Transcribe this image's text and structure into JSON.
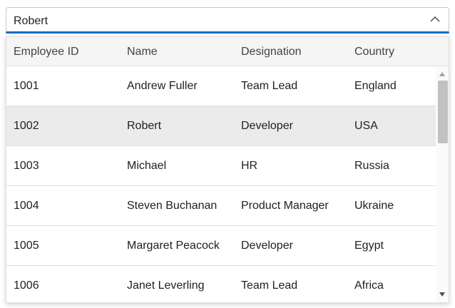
{
  "dropdown": {
    "value": "Robert",
    "icon": "chevron-up-icon"
  },
  "grid": {
    "columns": [
      "Employee ID",
      "Name",
      "Designation",
      "Country"
    ],
    "rows": [
      {
        "id": "1001",
        "name": "Andrew Fuller",
        "designation": "Team Lead",
        "country": "England"
      },
      {
        "id": "1002",
        "name": "Robert",
        "designation": "Developer",
        "country": "USA"
      },
      {
        "id": "1003",
        "name": "Michael",
        "designation": "HR",
        "country": "Russia"
      },
      {
        "id": "1004",
        "name": "Steven Buchanan",
        "designation": "Product Manager",
        "country": "Ukraine"
      },
      {
        "id": "1005",
        "name": "Margaret Peacock",
        "designation": "Developer",
        "country": "Egypt"
      },
      {
        "id": "1006",
        "name": "Janet Leverling",
        "designation": "Team Lead",
        "country": "Africa"
      }
    ],
    "selected_index": 1
  },
  "colors": {
    "accent": "#0f6cbd",
    "selected_row": "#ebebeb",
    "header_bg": "#f5f5f5"
  }
}
